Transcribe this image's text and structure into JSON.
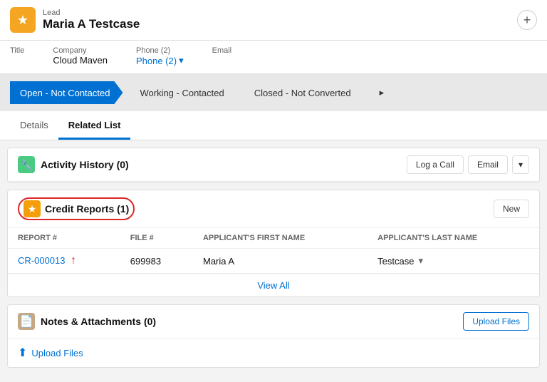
{
  "header": {
    "label": "Lead",
    "name": "Maria A Testcase",
    "plus_label": "+"
  },
  "fields": [
    {
      "label": "Title",
      "value": ""
    },
    {
      "label": "Company",
      "value": "Cloud Maven"
    },
    {
      "label": "Phone (2)",
      "value": "Phone (2)",
      "is_phone": true
    },
    {
      "label": "Email",
      "value": ""
    }
  ],
  "status_steps": [
    {
      "label": "Open - Not Contacted",
      "active": true
    },
    {
      "label": "Working - Contacted",
      "active": false
    },
    {
      "label": "Closed - Not Converted",
      "active": false
    },
    {
      "label": "",
      "active": false
    }
  ],
  "tabs": [
    {
      "label": "Details",
      "active": false
    },
    {
      "label": "Related List",
      "active": true
    }
  ],
  "sections": [
    {
      "id": "activity-history",
      "title": "Activity History (0)",
      "icon_type": "green",
      "icon_char": "🔧",
      "actions": [
        {
          "label": "Log a Call",
          "type": "btn"
        },
        {
          "label": "Email",
          "type": "btn"
        },
        {
          "label": "▾",
          "type": "dropdown"
        }
      ],
      "has_table": false,
      "has_view_all": false
    },
    {
      "id": "credit-reports",
      "title": "Credit Reports (1)",
      "icon_type": "orange",
      "icon_char": "★",
      "highlight": true,
      "actions": [
        {
          "label": "New",
          "type": "btn"
        }
      ],
      "has_table": true,
      "columns": [
        "Report #",
        "File #",
        "Applicant's First Name",
        "Applicant's Last Name"
      ],
      "rows": [
        {
          "report": "CR-000013",
          "file": "699983",
          "first_name": "Maria A",
          "last_name": "Testcase"
        }
      ],
      "has_view_all": true,
      "view_all_label": "View All"
    },
    {
      "id": "notes-attachments",
      "title": "Notes & Attachments (0)",
      "icon_type": "tan",
      "icon_char": "📄",
      "actions": [
        {
          "label": "Upload Files",
          "type": "upload"
        }
      ],
      "has_table": false,
      "has_view_all": false
    }
  ]
}
